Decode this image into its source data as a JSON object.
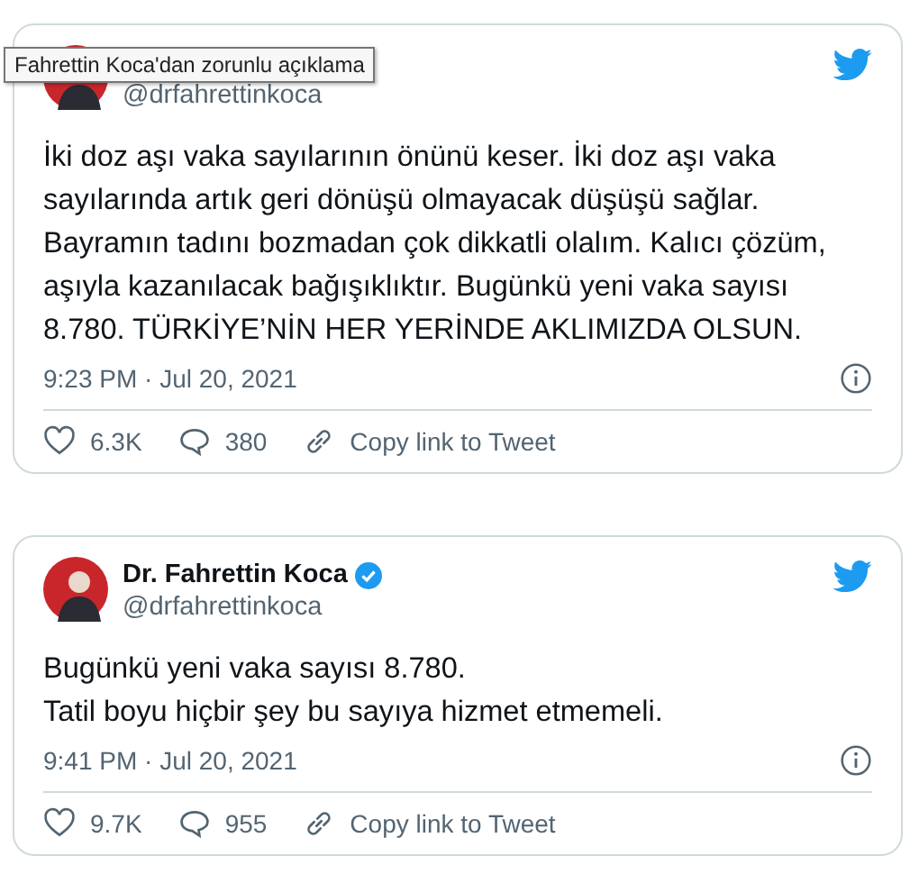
{
  "tooltip": "Fahrettin Koca'dan zorunlu açıklama",
  "tweets": [
    {
      "handle": "@drfahrettinkoca",
      "text": "İki doz aşı vaka sayılarının önünü keser. İki doz aşı vaka\nsayılarında artık geri dönüşü olmayacak düşüşü sağlar.\nBayramın tadını bozmadan çok dikkatli olalım. Kalıcı çözüm,\naşıyla kazanılacak bağışıklıktır. Bugünkü yeni vaka sayısı\n8.780. TÜRKİYE’NİN HER YERİNDE AKLIMIZDA OLSUN.",
      "time": "9:23 PM · Jul 20, 2021",
      "likes": "6.3K",
      "replies": "380",
      "copy": "Copy link to Tweet"
    },
    {
      "name": "Dr. Fahrettin Koca",
      "verified": true,
      "handle": "@drfahrettinkoca",
      "text": "Bugünkü yeni vaka sayısı 8.780.\nTatil boyu hiçbir şey bu sayıya hizmet etmemeli.",
      "time": "9:41 PM · Jul 20, 2021",
      "likes": "9.7K",
      "replies": "955",
      "copy": "Copy link to Tweet"
    }
  ]
}
